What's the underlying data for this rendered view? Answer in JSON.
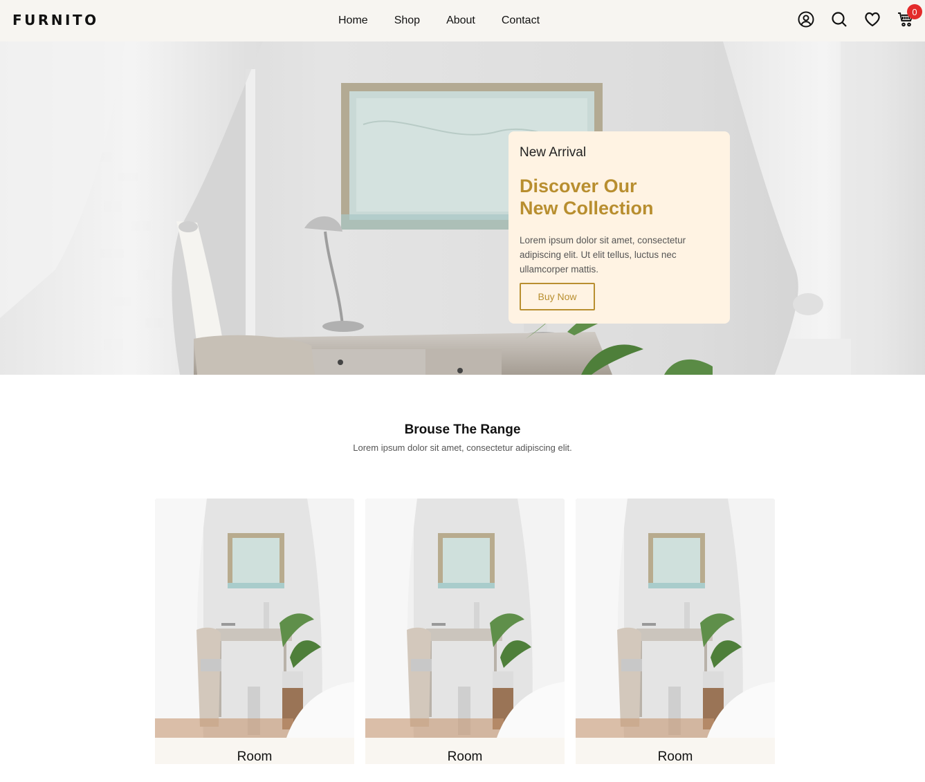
{
  "brand": {
    "logo": "FURNITO"
  },
  "nav": {
    "items": [
      {
        "label": "Home"
      },
      {
        "label": "Shop"
      },
      {
        "label": "About"
      },
      {
        "label": "Contact"
      }
    ]
  },
  "header_icons": {
    "account": "user-circle-icon",
    "search": "search-icon",
    "wishlist": "heart-icon",
    "cart": "cart-icon",
    "cart_count": "0",
    "cart_badge_color": "#e32b2b"
  },
  "hero": {
    "kicker": "New Arrival",
    "headline": "Discover Our New Collection",
    "description": "Lorem ipsum dolor sit amet, consectetur adipiscing elit. Ut elit tellus, luctus nec ullamcorper mattis.",
    "cta": "Buy Now",
    "accent_color": "#b88e2f",
    "panel_color": "#fff3e3"
  },
  "range": {
    "title": "Brouse The Range",
    "subtitle": "Lorem ipsum dolor sit amet, consectetur adipiscing elit.",
    "cards": [
      {
        "label": "Room"
      },
      {
        "label": "Room"
      },
      {
        "label": "Room"
      }
    ]
  }
}
